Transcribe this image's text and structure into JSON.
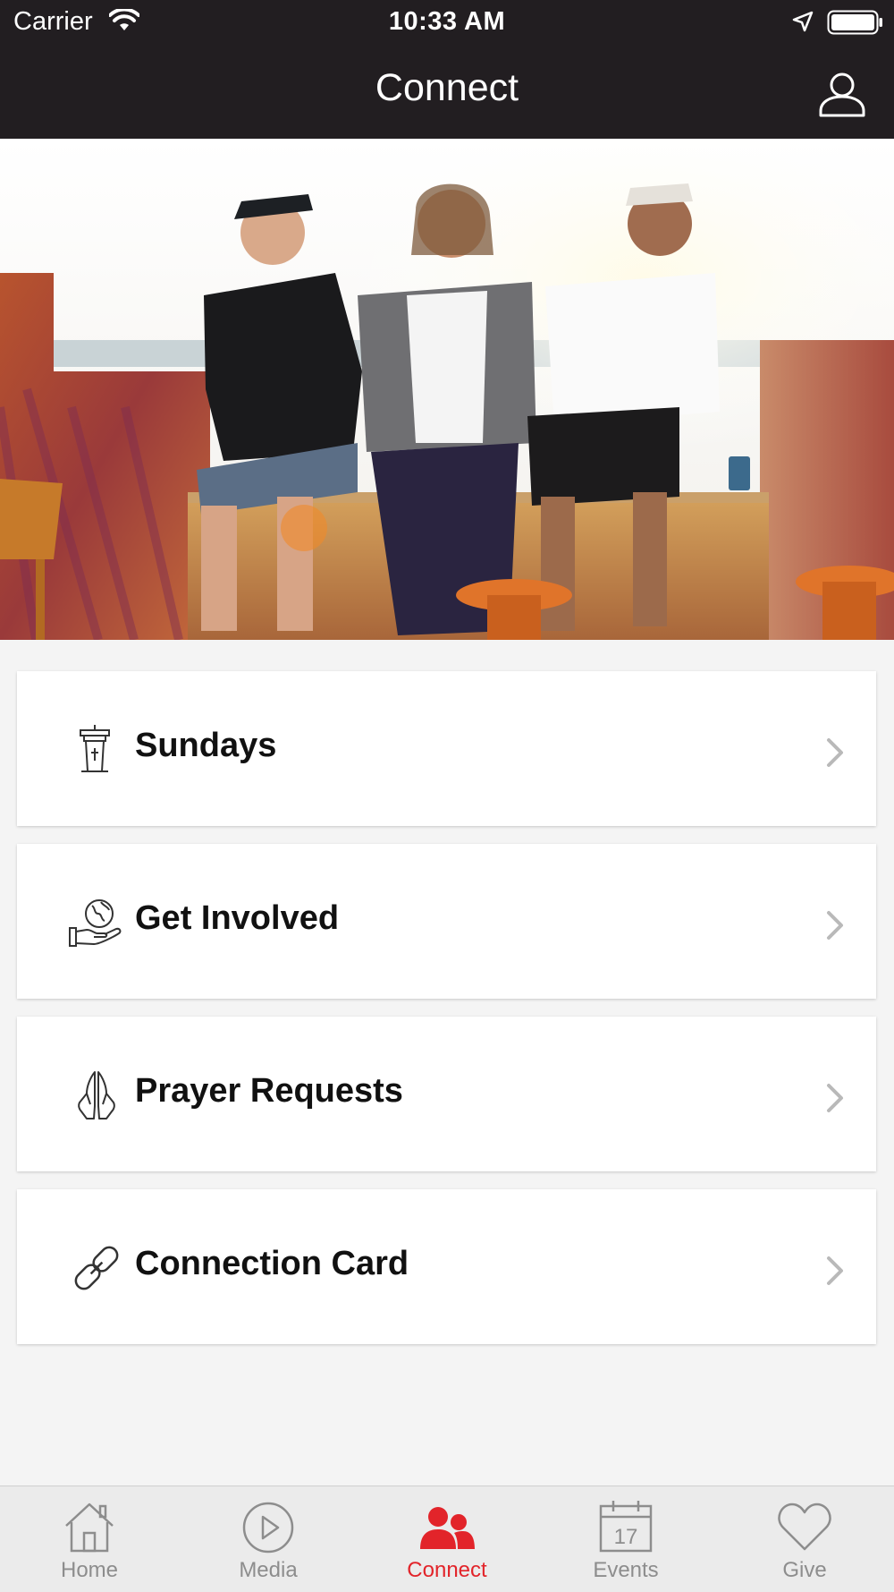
{
  "status_bar": {
    "carrier": "Carrier",
    "time": "10:33 AM"
  },
  "header": {
    "title": "Connect"
  },
  "menu": [
    {
      "label": "Sundays",
      "icon": "pulpit-icon"
    },
    {
      "label": "Get Involved",
      "icon": "hand-globe-icon"
    },
    {
      "label": "Prayer Requests",
      "icon": "praying-hands-icon"
    },
    {
      "label": "Connection Card",
      "icon": "link-icon"
    }
  ],
  "tabs": [
    {
      "label": "Home",
      "icon": "home-icon"
    },
    {
      "label": "Media",
      "icon": "play-icon"
    },
    {
      "label": "Connect",
      "icon": "people-icon",
      "active": true
    },
    {
      "label": "Events",
      "icon": "calendar-icon",
      "calendar_day": "17"
    },
    {
      "label": "Give",
      "icon": "heart-icon"
    }
  ],
  "colors": {
    "bar_bg": "#221e21",
    "accent": "#e2242a",
    "inactive": "#8d8d8d"
  }
}
